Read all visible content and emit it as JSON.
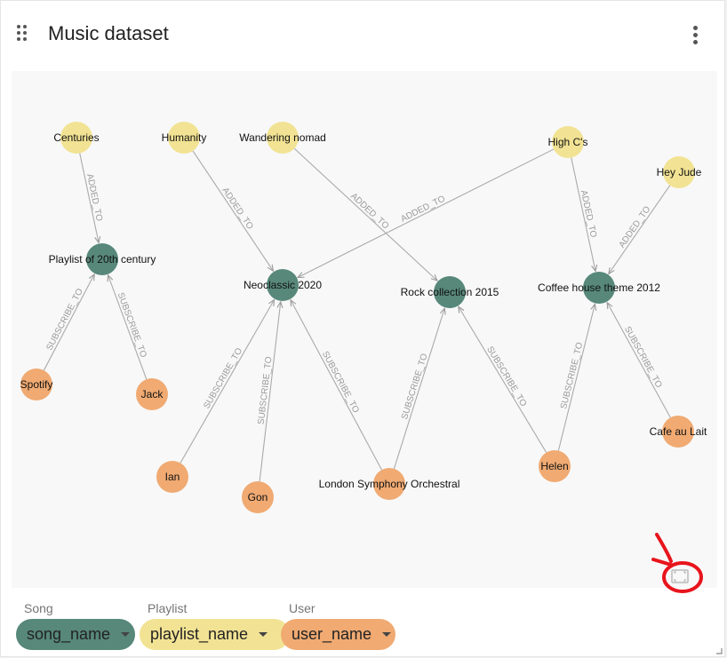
{
  "header": {
    "title": "Music dataset",
    "drag_icon": "drag-handle-icon",
    "menu_icon": "more-vert-icon"
  },
  "graph": {
    "nodes": [
      {
        "id": "centuries",
        "label": "Centuries",
        "type": "playlist"
      },
      {
        "id": "humanity",
        "label": "Humanity",
        "type": "playlist"
      },
      {
        "id": "wandering",
        "label": "Wandering nomad",
        "type": "playlist"
      },
      {
        "id": "highcs",
        "label": "High C's",
        "type": "playlist"
      },
      {
        "id": "heyjude",
        "label": "Hey Jude",
        "type": "playlist"
      },
      {
        "id": "pl20",
        "label": "Playlist of 20th century",
        "type": "song"
      },
      {
        "id": "neo",
        "label": "Neoclassic 2020",
        "type": "song"
      },
      {
        "id": "rock",
        "label": "Rock collection 2015",
        "type": "song"
      },
      {
        "id": "coffee",
        "label": "Coffee house theme 2012",
        "type": "song"
      },
      {
        "id": "spotify",
        "label": "Spotify",
        "type": "user"
      },
      {
        "id": "jack",
        "label": "Jack",
        "type": "user"
      },
      {
        "id": "ian",
        "label": "Ian",
        "type": "user"
      },
      {
        "id": "gon",
        "label": "Gon",
        "type": "user"
      },
      {
        "id": "lso",
        "label": "London Symphony Orchestral",
        "type": "user"
      },
      {
        "id": "helen",
        "label": "Helen",
        "type": "user"
      },
      {
        "id": "cafe",
        "label": "Cafe au Lait",
        "type": "user"
      }
    ],
    "edges": [
      {
        "from": "centuries",
        "to": "pl20",
        "label": "ADDED_TO"
      },
      {
        "from": "humanity",
        "to": "neo",
        "label": "ADDED_TO"
      },
      {
        "from": "wandering",
        "to": "rock",
        "label": "ADDED_TO"
      },
      {
        "from": "highcs",
        "to": "neo",
        "label": "ADDED_TO"
      },
      {
        "from": "highcs",
        "to": "coffee",
        "label": "ADDED_TO"
      },
      {
        "from": "heyjude",
        "to": "coffee",
        "label": "ADDED_TO"
      },
      {
        "from": "spotify",
        "to": "pl20",
        "label": "SUBSCRIBE_TO"
      },
      {
        "from": "jack",
        "to": "pl20",
        "label": "SUBSCRIBE_TO"
      },
      {
        "from": "ian",
        "to": "neo",
        "label": "SUBSCRIBE_TO"
      },
      {
        "from": "gon",
        "to": "neo",
        "label": "SUBSCRIBE_TO"
      },
      {
        "from": "lso",
        "to": "neo",
        "label": "SUBSCRIBE_TO"
      },
      {
        "from": "lso",
        "to": "rock",
        "label": "SUBSCRIBE_TO"
      },
      {
        "from": "helen",
        "to": "rock",
        "label": "SUBSCRIBE_TO"
      },
      {
        "from": "helen",
        "to": "coffee",
        "label": "SUBSCRIBE_TO"
      },
      {
        "from": "cafe",
        "to": "coffee",
        "label": "SUBSCRIBE_TO"
      }
    ]
  },
  "legend": [
    {
      "caption": "Song",
      "value": "song_name",
      "type": "song"
    },
    {
      "caption": "Playlist",
      "value": "playlist_name",
      "type": "playlist"
    },
    {
      "caption": "User",
      "value": "user_name",
      "type": "user"
    }
  ],
  "colors": {
    "song": "#57887a",
    "playlist": "#f2e394",
    "user": "#f0aa72",
    "edge": "#aaaaaa",
    "annotation": "#e8141c"
  },
  "controls": {
    "fit_icon": "fit-to-screen-icon",
    "resize_icon": "resize-grip-icon"
  }
}
